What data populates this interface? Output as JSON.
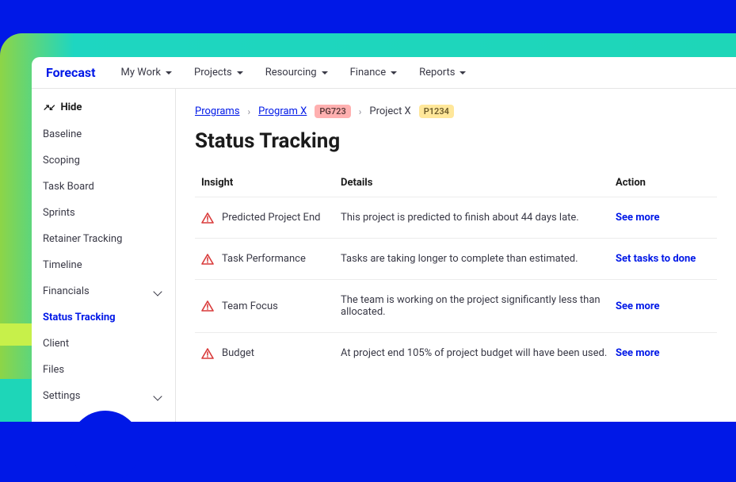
{
  "brand": "Forecast",
  "nav": [
    {
      "label": "My Work"
    },
    {
      "label": "Projects"
    },
    {
      "label": "Resourcing"
    },
    {
      "label": "Finance"
    },
    {
      "label": "Reports"
    }
  ],
  "sidebar": {
    "hide": "Hide",
    "items": [
      {
        "label": "Baseline",
        "expandable": false
      },
      {
        "label": "Scoping",
        "expandable": false
      },
      {
        "label": "Task Board",
        "expandable": false
      },
      {
        "label": "Sprints",
        "expandable": false
      },
      {
        "label": "Retainer Tracking",
        "expandable": false
      },
      {
        "label": "Timeline",
        "expandable": false
      },
      {
        "label": "Financials",
        "expandable": true
      },
      {
        "label": "Status Tracking",
        "expandable": false,
        "active": true
      },
      {
        "label": "Client",
        "expandable": false
      },
      {
        "label": "Files",
        "expandable": false
      },
      {
        "label": "Settings",
        "expandable": true
      }
    ]
  },
  "breadcrumb": {
    "programs": "Programs",
    "program_x": "Program X",
    "pg_badge": "PG723",
    "project_x": "Project X",
    "p_badge": "P1234"
  },
  "page_title": "Status Tracking",
  "columns": {
    "insight": "Insight",
    "details": "Details",
    "action": "Action"
  },
  "rows": [
    {
      "insight": "Predicted Project End",
      "details": "This project is predicted to finish about 44 days late.",
      "action": "See more"
    },
    {
      "insight": "Task Performance",
      "details": "Tasks are taking longer to complete than estimated.",
      "action": "Set tasks to done"
    },
    {
      "insight": "Team Focus",
      "details": "The team is working on the project significantly less than allocated.",
      "action": "See more"
    },
    {
      "insight": "Budget",
      "details": "At project end 105% of project budget will have been used.",
      "action": "See more"
    }
  ]
}
